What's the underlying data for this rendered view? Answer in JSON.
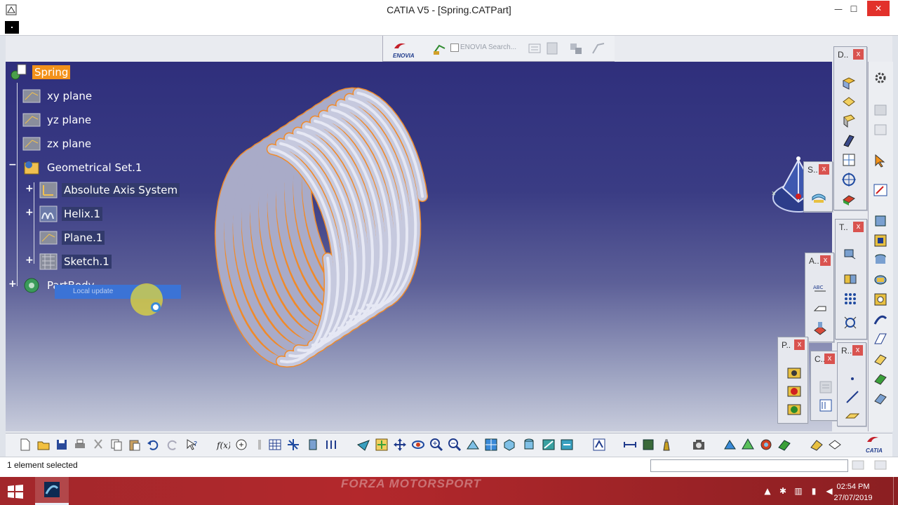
{
  "window": {
    "title": "CATIA V5 - [Spring.CATPart]",
    "minimize_glyph": "—",
    "maximize_glyph": "☐",
    "close_glyph": "✕"
  },
  "top_toolbar": {
    "enovia_search_placeholder": "ENOVIA Search..."
  },
  "spec_tree": {
    "root": "Spring",
    "items": [
      {
        "label": "xy plane"
      },
      {
        "label": "yz plane"
      },
      {
        "label": "zx plane"
      },
      {
        "label": "Geometrical Set.1"
      },
      {
        "label": "Absolute Axis System"
      },
      {
        "label": "Helix.1"
      },
      {
        "label": "Plane.1"
      },
      {
        "label": "Sketch.1"
      },
      {
        "label": "PartBody"
      }
    ],
    "update_popup": "Local update"
  },
  "panels": {
    "d": {
      "title": "D..",
      "close": "x"
    },
    "s": {
      "title": "S..",
      "close": "x"
    },
    "t": {
      "title": "T..",
      "close": "x"
    },
    "a": {
      "title": "A..",
      "close": "x"
    },
    "p": {
      "title": "P..",
      "close": "x"
    },
    "c": {
      "title": "C..",
      "close": "x"
    },
    "r": {
      "title": "R..",
      "close": "x"
    }
  },
  "status_bar": {
    "message": "1 element selected"
  },
  "taskbar": {
    "wallpaper_text": "FORZA MOTORSPORT",
    "time": "02:54 PM",
    "date": "27/07/2019"
  },
  "colors": {
    "selection": "#f3921a",
    "spring_edge": "#f08a2a",
    "spring_body": "#c6c9de"
  }
}
